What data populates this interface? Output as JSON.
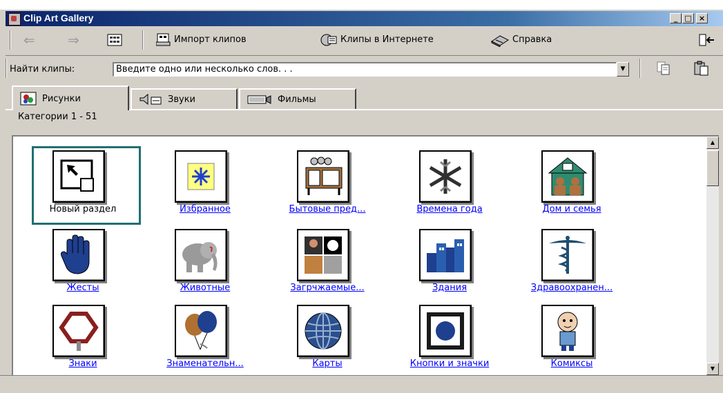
{
  "window": {
    "title": "Clip Art Gallery"
  },
  "caption_buttons": {
    "minimize": "_",
    "maximize": "□",
    "close": "×"
  },
  "toolbar": {
    "back_label": "⇐",
    "forward_label": "⇒",
    "import_label": "Импорт клипов",
    "online_label": "Клипы в Интернете",
    "help_label": "Справка"
  },
  "search": {
    "label": "Найти клипы:",
    "placeholder": "Введите одно или несколько слов. . ."
  },
  "tabs": [
    {
      "label": "Рисунки"
    },
    {
      "label": "Звуки"
    },
    {
      "label": "Фильмы"
    }
  ],
  "category_range": "Категории 1 - 51",
  "categories": [
    {
      "label": "Новый раздел"
    },
    {
      "label": "Избранное"
    },
    {
      "label": "Бытовые пред..."
    },
    {
      "label": "Времена года"
    },
    {
      "label": "Дом и семья"
    },
    {
      "label": "Жесты"
    },
    {
      "label": "Животные"
    },
    {
      "label": "Загрчжаемые..."
    },
    {
      "label": "Здания"
    },
    {
      "label": "Здравоохранен..."
    },
    {
      "label": "Знаки"
    },
    {
      "label": "Знаменательн..."
    },
    {
      "label": "Карты"
    },
    {
      "label": "Кнопки и значки"
    },
    {
      "label": "Комиксы"
    }
  ],
  "colors": {
    "title_start": "#0a246a",
    "title_end": "#a6caf0",
    "link": "#0000ff",
    "selection": "#1f6f73"
  }
}
